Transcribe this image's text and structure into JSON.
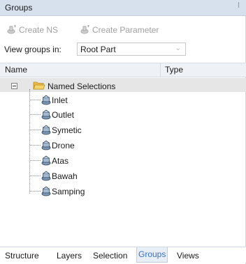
{
  "panel": {
    "title": "Groups"
  },
  "toolbar": {
    "create_ns": "Create NS",
    "create_parameter": "Create Parameter"
  },
  "view_groups": {
    "label": "View groups in:",
    "value": "Root Part",
    "arrow": "⌄"
  },
  "columns": {
    "name": "Name",
    "type": "Type"
  },
  "tree": {
    "root": {
      "label": "Named Selections"
    },
    "children": [
      {
        "label": "Inlet"
      },
      {
        "label": "Outlet"
      },
      {
        "label": "Symetic"
      },
      {
        "label": "Drone"
      },
      {
        "label": "Atas"
      },
      {
        "label": "Bawah"
      },
      {
        "label": "Samping"
      }
    ]
  },
  "tabs": [
    {
      "label": "Structure"
    },
    {
      "label": "Layers"
    },
    {
      "label": "Selection"
    },
    {
      "label": "Groups",
      "active": true
    },
    {
      "label": "Views"
    }
  ],
  "colors": {
    "accent": "#3a73c2",
    "title_bg": "#d6e1ed",
    "disabled_text": "#a0a0a0"
  }
}
